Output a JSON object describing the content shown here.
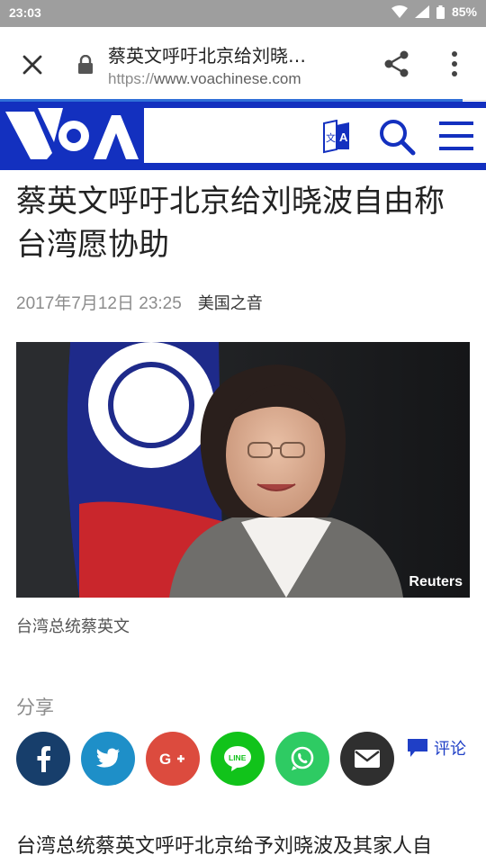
{
  "status_bar": {
    "time": "23:03",
    "battery": "85%"
  },
  "browser": {
    "page_title": "蔡英文呼吁北京给刘晓…",
    "url_scheme": "https://",
    "url_host": "www.voachinese.com"
  },
  "article": {
    "headline": "蔡英文呼吁北京给刘晓波自由称台湾愿协助",
    "date": "2017年7月12日 23:25",
    "source": "美国之音",
    "photo_credit": "Reuters",
    "caption": "台湾总统蔡英文",
    "share_label": "分享",
    "comment_label": "评论",
    "body_first_line": "台湾总统蔡英文呼吁北京给予刘晓波及其家人自"
  },
  "share_buttons": [
    {
      "name": "facebook",
      "icon": "facebook-icon",
      "color": "#173e6b"
    },
    {
      "name": "twitter",
      "icon": "twitter-icon",
      "color": "#1e8fc8"
    },
    {
      "name": "google-plus",
      "icon": "google-plus-icon",
      "color": "#dc4b3e"
    },
    {
      "name": "line",
      "icon": "line-icon",
      "color": "#11c31a"
    },
    {
      "name": "whatsapp",
      "icon": "whatsapp-icon",
      "color": "#2ecb63"
    },
    {
      "name": "email",
      "icon": "email-icon",
      "color": "#2f2f2f"
    }
  ],
  "colors": {
    "voa_blue": "#1330bf",
    "accent": "#1f3fc6"
  }
}
